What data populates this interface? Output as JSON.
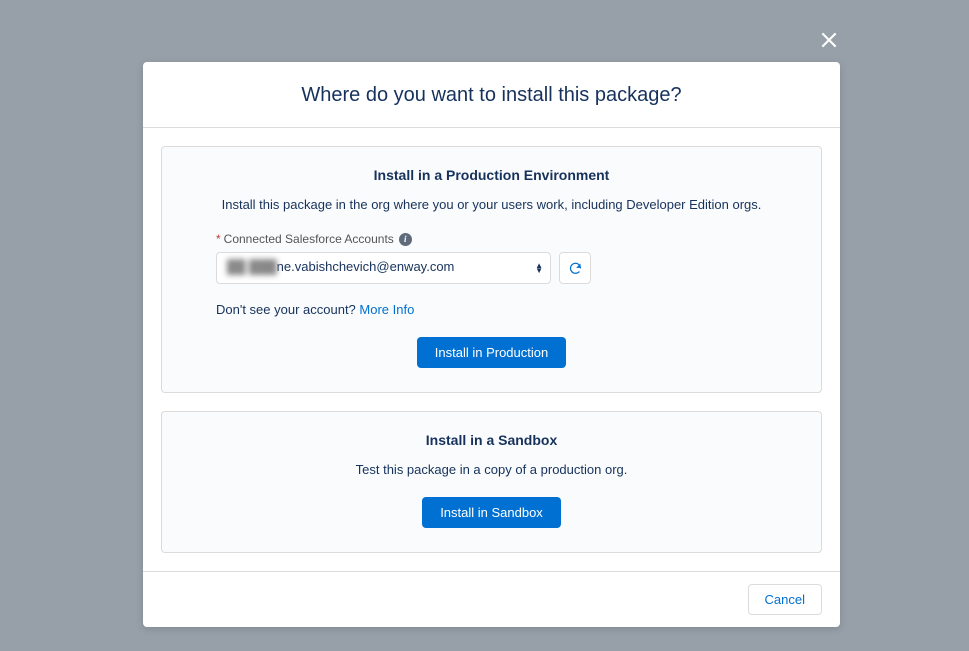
{
  "modal": {
    "title": "Where do you want to install this package?",
    "cancel_label": "Cancel"
  },
  "production": {
    "title": "Install in a Production Environment",
    "description": "Install this package in the org where you or your users work, including Developer Edition orgs.",
    "field_label": "Connected Salesforce Accounts",
    "selected_account_obscured": "██ ███",
    "selected_account_visible": "ne.vabishchevich@enway.com",
    "no_account_text": "Don't see your account? ",
    "more_info_label": "More Info",
    "button_label": "Install in Production"
  },
  "sandbox": {
    "title": "Install in a Sandbox",
    "description": "Test this package in a copy of a production org.",
    "button_label": "Install in Sandbox"
  }
}
